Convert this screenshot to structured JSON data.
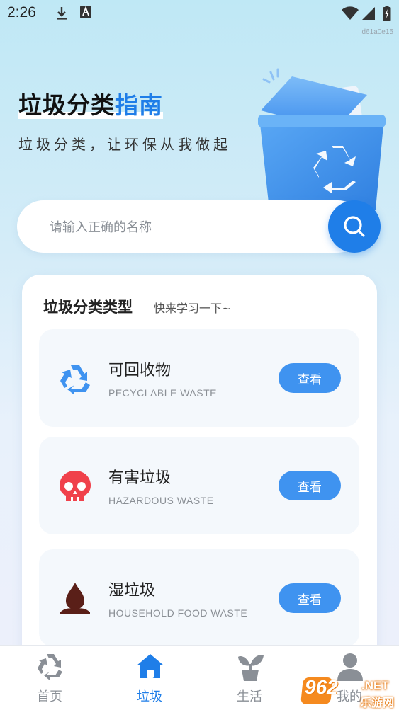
{
  "status_bar": {
    "time": "2:26",
    "build_tag": "d61a0e15"
  },
  "hero": {
    "title_part1": "垃圾分类",
    "title_part2": "指南",
    "subtitle": "垃圾分类，让环保从我做起"
  },
  "search": {
    "placeholder": "请输入正确的名称"
  },
  "section": {
    "title": "垃圾分类类型",
    "subtitle": "快来学习一下~"
  },
  "categories": [
    {
      "name": "可回收物",
      "english": "PECYCLABLE WASTE",
      "button": "查看",
      "icon": "recycle-icon",
      "color": "#3f93f0"
    },
    {
      "name": "有害垃圾",
      "english": "HAZARDOUS WASTE",
      "button": "查看",
      "icon": "skull-icon",
      "color": "#f0414b"
    },
    {
      "name": "湿垃圾",
      "english": "HOUSEHOLD FOOD WASTE",
      "button": "查看",
      "icon": "drop-icon",
      "color": "#5a1f18"
    }
  ],
  "tabs": [
    {
      "label": "首页",
      "icon": "recycle-icon",
      "active": false
    },
    {
      "label": "垃圾",
      "icon": "home-icon",
      "active": true
    },
    {
      "label": "生活",
      "icon": "plant-icon",
      "active": false
    },
    {
      "label": "我的",
      "icon": "user-icon",
      "active": false
    }
  ],
  "watermark": {
    "number": "962",
    "suffix": ".NET",
    "site": "乐游网"
  },
  "colors": {
    "accent": "#1f7ee8",
    "button": "#3f93f0",
    "inactive": "#8a8f96"
  }
}
